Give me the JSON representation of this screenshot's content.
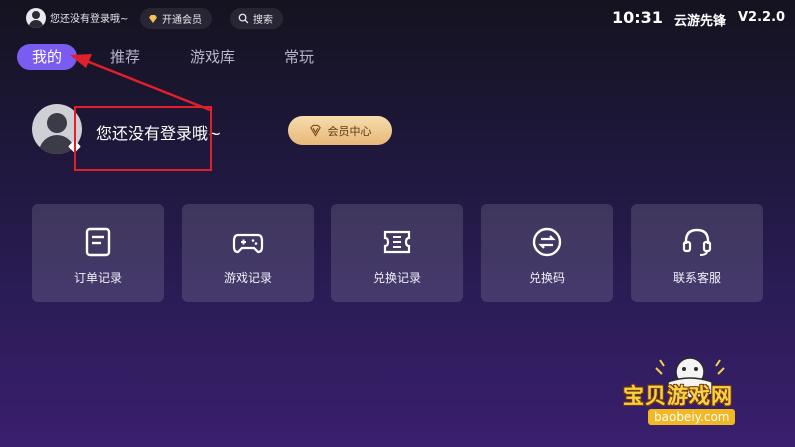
{
  "topbar": {
    "user_label": "您还没有登录哦~",
    "member_label": "开通会员",
    "search_label": "搜索",
    "time": "10:31",
    "app_name": "云游先锋",
    "version": "V2.2.0"
  },
  "tabs": [
    {
      "label": "我的",
      "active": true
    },
    {
      "label": "推荐",
      "active": false
    },
    {
      "label": "游戏库",
      "active": false
    },
    {
      "label": "常玩",
      "active": false
    }
  ],
  "profile": {
    "login_prompt": "您还没有登录哦~",
    "member_center_label": "会员中心"
  },
  "cards": [
    {
      "label": "订单记录",
      "icon": "document-icon"
    },
    {
      "label": "游戏记录",
      "icon": "gamepad-icon"
    },
    {
      "label": "兑换记录",
      "icon": "ticket-icon"
    },
    {
      "label": "兑换码",
      "icon": "exchange-icon"
    },
    {
      "label": "联系客服",
      "icon": "headset-icon"
    }
  ],
  "watermark": {
    "title": "宝贝游戏网",
    "url": "baobeiy.com"
  },
  "colors": {
    "accent": "#7b5cf0",
    "annotation": "#e0202a",
    "gold": "#e7b878"
  }
}
